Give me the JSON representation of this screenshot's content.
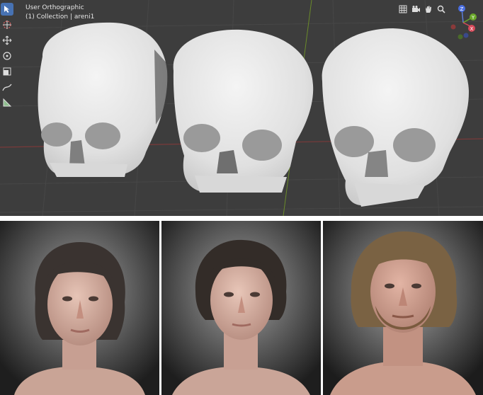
{
  "viewport": {
    "view_name": "User Orthographic",
    "collection": "(1) Collection | areni1",
    "active_tool": "select-box",
    "tools": [
      "select-box",
      "cursor",
      "move",
      "rotate",
      "scale",
      "annotate",
      "measure"
    ],
    "nav_icons": [
      "grid-icon",
      "camera-icon",
      "hand-icon",
      "zoom-icon"
    ],
    "gizmo_axes": [
      "Z",
      "Y",
      "X"
    ],
    "colors": {
      "background": "#3d3d3d",
      "grid": "#474747",
      "x_axis": "#7a3a3a",
      "y_axis": "#6a8a2a",
      "active_tool": "#4772b3",
      "skull": "#e6e6e6"
    }
  },
  "reconstructions": {
    "count": 3,
    "skin_colors": [
      "#d7b2a4",
      "#d8b3a6",
      "#d3a596"
    ],
    "hair_colors": [
      "#3a3330",
      "#332c28",
      "#7a6243"
    ]
  }
}
